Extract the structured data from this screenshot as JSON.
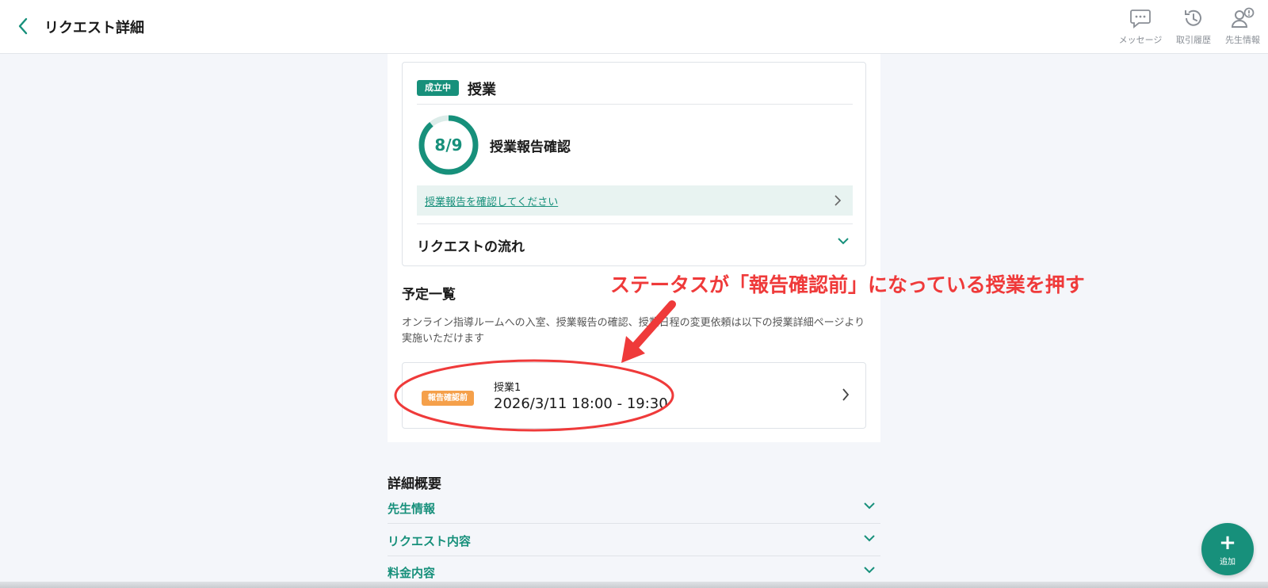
{
  "header": {
    "title": "リクエスト詳細",
    "buttons": [
      {
        "label": "メッセージ",
        "icon": "message-icon"
      },
      {
        "label": "取引履歴",
        "icon": "history-icon"
      },
      {
        "label": "先生情報",
        "icon": "teacher-info-icon"
      }
    ]
  },
  "lesson_card": {
    "status_badge": "成立中",
    "title": "授業",
    "progress_text": "8/9",
    "progress_done": 8,
    "progress_total": 9,
    "report_heading": "授業報告確認",
    "report_link": "授業報告を確認してください",
    "flow_label": "リクエストの流れ"
  },
  "schedule": {
    "title": "予定一覧",
    "description": "オンライン指導ルームへの入室、授業報告の確認、授業日程の変更依頼は以下の授業詳細ページより実施いただけます",
    "items": [
      {
        "badge": "報告確認前",
        "name": "授業1",
        "datetime": "2026/3/11 18:00 - 19:30"
      }
    ]
  },
  "annotation": {
    "text": "ステータスが「報告確認前」になっている授業を押す",
    "color": "#ef3a3a"
  },
  "details": {
    "title": "詳細概要",
    "items": [
      "先生情報",
      "リクエスト内容",
      "料金内容"
    ]
  },
  "fab": {
    "symbol": "+",
    "label": "追加"
  },
  "colors": {
    "accent": "#17907b",
    "warning": "#f5a04a",
    "annotation": "#ef3a3a"
  }
}
